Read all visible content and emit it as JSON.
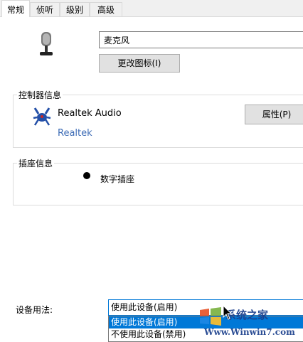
{
  "tabs": [
    "常规",
    "侦听",
    "级别",
    "高级"
  ],
  "device": {
    "name": "麦克风",
    "change_icon_label": "更改图标(I)"
  },
  "controller": {
    "group_title": "控制器信息",
    "name": "Realtek Audio",
    "vendor": "Realtek",
    "properties_label": "属性(P)"
  },
  "jack": {
    "group_title": "插座信息",
    "label": "数字插座"
  },
  "usage": {
    "label": "设备用法:",
    "selected": "使用此设备(启用)",
    "options": [
      "使用此设备(启用)",
      "不使用此设备(禁用)"
    ]
  },
  "watermark": {
    "brand": "系统之家",
    "url": "Www.Winwin7.com"
  },
  "icons": {
    "device": "microphone-icon",
    "controller": "realtek-crab-icon",
    "jack": "jack-bullet-icon"
  },
  "colors": {
    "accent": "#0078d7",
    "link": "#3c6bb5"
  }
}
